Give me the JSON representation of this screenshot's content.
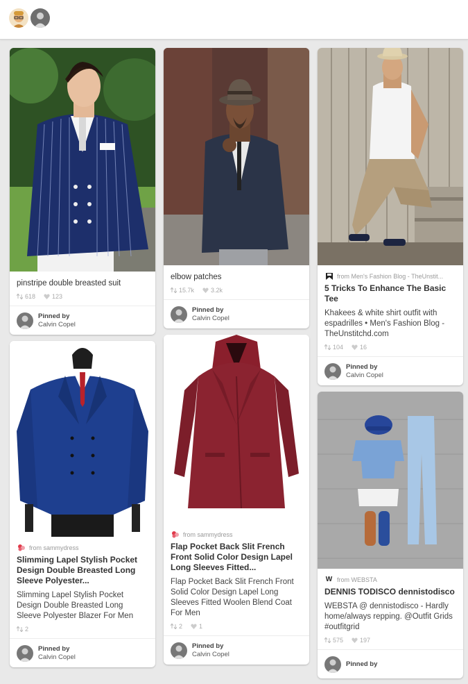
{
  "header": {
    "avatars": [
      "user-avatar",
      "pinner-avatar"
    ]
  },
  "pins": {
    "p1": {
      "title": "pinstripe double breasted suit",
      "repins": "618",
      "likes": "123",
      "pinned_by_label": "Pinned by",
      "pinner": "Calvin Copel"
    },
    "p2": {
      "title": "elbow patches",
      "repins": "15.7k",
      "likes": "3.2k",
      "pinned_by_label": "Pinned by",
      "pinner": "Calvin Copel"
    },
    "p3": {
      "source": "from Men's Fashion Blog - TheUnstit...",
      "title": "5 Tricks To Enhance The Basic Tee",
      "description": "Khakees & white shirt outfit with espadrilles • Men's Fashion Blog - TheUnstitchd.com",
      "repins": "104",
      "likes": "16",
      "pinned_by_label": "Pinned by",
      "pinner": "Calvin Copel"
    },
    "p4": {
      "source": "from sammydress",
      "title": "Slimming Lapel Stylish Pocket Design Double Breasted Long Sleeve Polyester...",
      "description": "Slimming Lapel Stylish Pocket Design Double Breasted Long Sleeve Polyester Blazer For Men",
      "repins": "2",
      "pinned_by_label": "Pinned by",
      "pinner": "Calvin Copel"
    },
    "p5": {
      "source": "from sammydress",
      "title": "Flap Pocket Back Slit French Front Solid Color Design Lapel Long Sleeves Fitted...",
      "description": "Flap Pocket Back Slit French Front Solid Color Design Lapel Long Sleeves Fitted Woolen Blend Coat For Men",
      "repins": "2",
      "likes": "1",
      "pinned_by_label": "Pinned by",
      "pinner": "Calvin Copel"
    },
    "p6": {
      "source": "from WEBSTA",
      "title": "DENNIS TODISCO dennistodisco",
      "description": "WEBSTA @ dennistodisco - Hardly home/always repping. @Outfit Grids #outfitgrid",
      "repins": "575",
      "likes": "197",
      "pinned_by_label": "Pinned by"
    }
  },
  "colors": {
    "pinterest_red": "#cb2027",
    "link_gray": "#999999",
    "background": "#e9e9e9"
  }
}
